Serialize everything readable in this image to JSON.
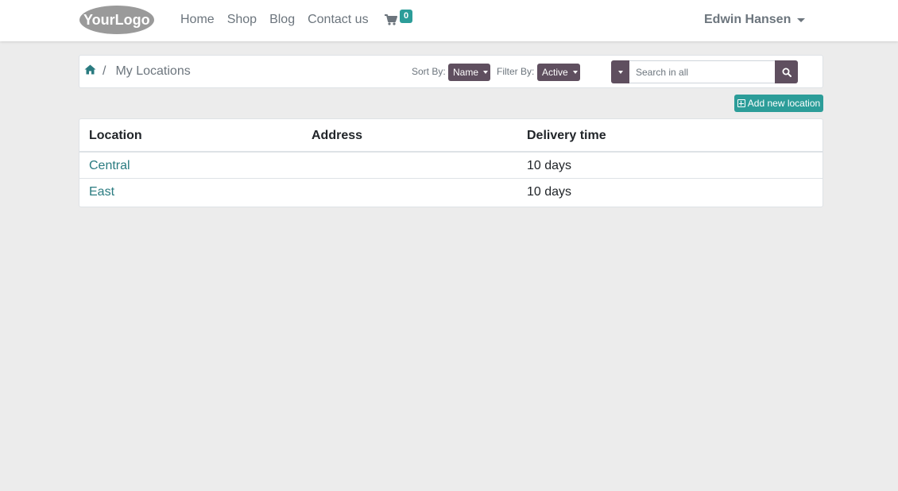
{
  "header": {
    "logo_alt": "YourLogo",
    "nav": [
      "Home",
      "Shop",
      "Blog",
      "Contact us"
    ],
    "cart_count": "0",
    "user_name": "Edwin Hansen"
  },
  "breadcrumb": {
    "separator": "/",
    "current": "My Locations"
  },
  "controls": {
    "sort_label": "Sort By:",
    "sort_value": "Name",
    "filter_label": "Filter By:",
    "filter_value": "Active",
    "search_placeholder": "Search in all"
  },
  "add_button": "Add new location",
  "table": {
    "columns": [
      "Location",
      "Address",
      "Delivery time"
    ],
    "rows": [
      {
        "location": "Central",
        "address": "",
        "delivery": "10 days"
      },
      {
        "location": "East",
        "address": "",
        "delivery": "10 days"
      }
    ]
  },
  "colors": {
    "primary": "#5f4f5f",
    "accent": "#2c9d99",
    "link": "#2a7b80"
  },
  "icons": {
    "home": "home-icon",
    "cart": "shopping-cart-icon",
    "search": "search-icon",
    "add": "plus-square-icon"
  }
}
